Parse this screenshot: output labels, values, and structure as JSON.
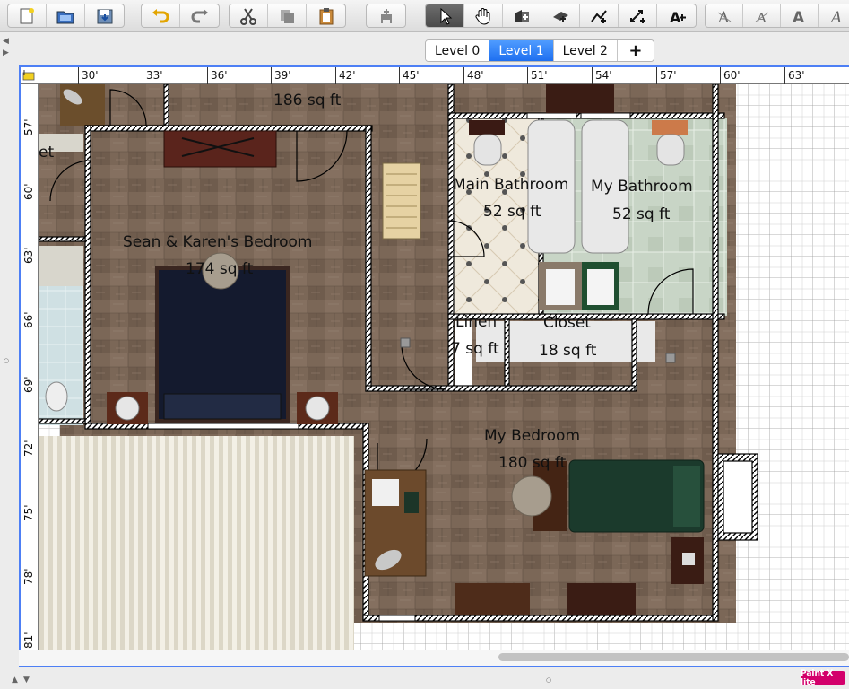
{
  "toolbar": {
    "groups": [
      [
        "new-file",
        "open-file",
        "save-file"
      ],
      [
        "undo",
        "redo"
      ],
      [
        "cut",
        "copy",
        "paste"
      ],
      [
        "add-furniture"
      ],
      [
        "select",
        "pan",
        "create-walls",
        "create-rooms",
        "create-polylines",
        "create-dimensions",
        "add-text"
      ],
      [
        "increase-text",
        "decrease-text",
        "bold-text",
        "italic-text"
      ]
    ]
  },
  "levels": {
    "tabs": [
      "Level 0",
      "Level 1",
      "Level 2"
    ],
    "selected": "Level 1",
    "add_label": "+"
  },
  "ruler": {
    "horizontal": [
      "30'",
      "33'",
      "36'",
      "39'",
      "42'",
      "45'",
      "48'",
      "51'",
      "54'",
      "57'",
      "60'",
      "63'"
    ],
    "vertical": [
      "57'",
      "60'",
      "63'",
      "66'",
      "69'",
      "72'",
      "75'",
      "78'",
      "81'"
    ]
  },
  "rooms": [
    {
      "name": "",
      "area": "186 sq ft"
    },
    {
      "name": "et",
      "area": ""
    },
    {
      "name": "Sean & Karen's Bedroom",
      "area": "174 sq ft"
    },
    {
      "name": "Main Bathroom",
      "area": "52 sq ft"
    },
    {
      "name": "My Bathroom",
      "area": "52 sq ft"
    },
    {
      "name": "Linen",
      "area": "7 sq ft"
    },
    {
      "name": "Closet",
      "area": "18 sq ft"
    },
    {
      "name": "My Bedroom",
      "area": "180 sq ft"
    }
  ],
  "badge": "Paint X lite",
  "colors": {
    "accent": "#4d7ff5",
    "selected_tab": "#2a78f5",
    "wood_floor": "#7a6656",
    "wall": "#ffffff"
  }
}
